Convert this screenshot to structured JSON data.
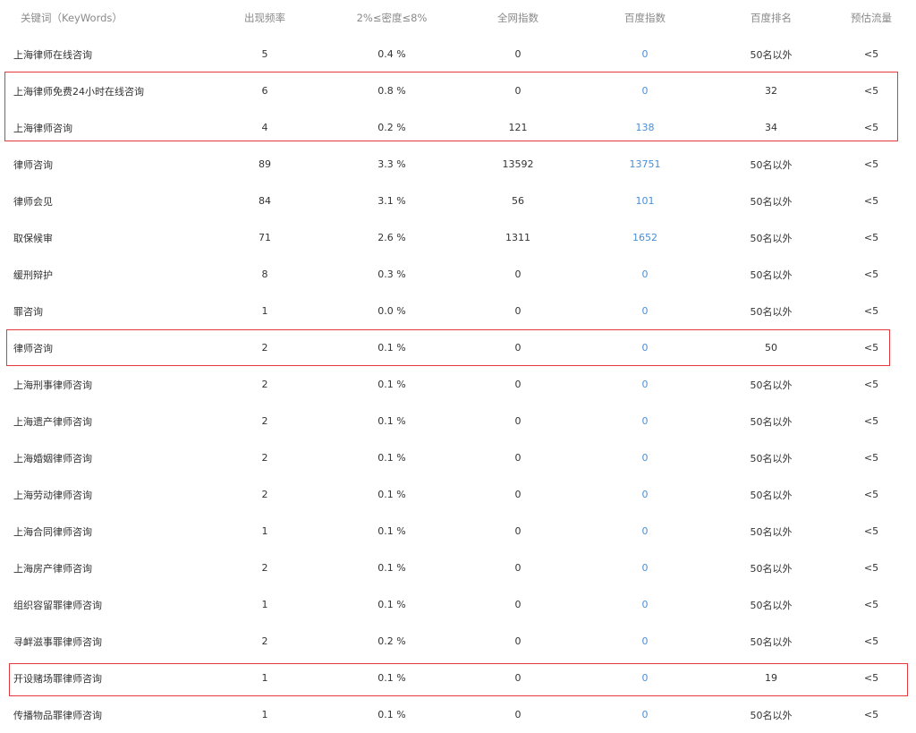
{
  "table": {
    "headers": {
      "keyword": "关键词（KeyWords）",
      "frequency": "出现频率",
      "density": "2%≤密度≤8%",
      "all_index": "全网指数",
      "baidu_index": "百度指数",
      "baidu_rank": "百度排名",
      "traffic": "预估流量"
    },
    "rows": [
      {
        "keyword": "上海律师在线咨询",
        "frequency": "5",
        "density": "0.4 %",
        "all_index": "0",
        "baidu_index": "0",
        "baidu_rank": "50名以外",
        "traffic": "<5"
      },
      {
        "keyword": "上海律师免费24小时在线咨询",
        "frequency": "6",
        "density": "0.8 %",
        "all_index": "0",
        "baidu_index": "0",
        "baidu_rank": "32",
        "traffic": "<5"
      },
      {
        "keyword": "上海律师咨询",
        "frequency": "4",
        "density": "0.2 %",
        "all_index": "121",
        "baidu_index": "138",
        "baidu_rank": "34",
        "traffic": "<5"
      },
      {
        "keyword": "律师咨询",
        "frequency": "89",
        "density": "3.3 %",
        "all_index": "13592",
        "baidu_index": "13751",
        "baidu_rank": "50名以外",
        "traffic": "<5"
      },
      {
        "keyword": "律师会见",
        "frequency": "84",
        "density": "3.1 %",
        "all_index": "56",
        "baidu_index": "101",
        "baidu_rank": "50名以外",
        "traffic": "<5"
      },
      {
        "keyword": "取保候审",
        "frequency": "71",
        "density": "2.6 %",
        "all_index": "1311",
        "baidu_index": "1652",
        "baidu_rank": "50名以外",
        "traffic": "<5"
      },
      {
        "keyword": "缓刑辩护",
        "frequency": "8",
        "density": "0.3 %",
        "all_index": "0",
        "baidu_index": "0",
        "baidu_rank": "50名以外",
        "traffic": "<5"
      },
      {
        "keyword": "罪咨询",
        "frequency": "1",
        "density": "0.0 %",
        "all_index": "0",
        "baidu_index": "0",
        "baidu_rank": "50名以外",
        "traffic": "<5"
      },
      {
        "keyword": "律师咨询",
        "frequency": "2",
        "density": "0.1 %",
        "all_index": "0",
        "baidu_index": "0",
        "baidu_rank": "50",
        "traffic": "<5"
      },
      {
        "keyword": "上海刑事律师咨询",
        "frequency": "2",
        "density": "0.1 %",
        "all_index": "0",
        "baidu_index": "0",
        "baidu_rank": "50名以外",
        "traffic": "<5"
      },
      {
        "keyword": "上海遗产律师咨询",
        "frequency": "2",
        "density": "0.1 %",
        "all_index": "0",
        "baidu_index": "0",
        "baidu_rank": "50名以外",
        "traffic": "<5"
      },
      {
        "keyword": "上海婚姻律师咨询",
        "frequency": "2",
        "density": "0.1 %",
        "all_index": "0",
        "baidu_index": "0",
        "baidu_rank": "50名以外",
        "traffic": "<5"
      },
      {
        "keyword": "上海劳动律师咨询",
        "frequency": "2",
        "density": "0.1 %",
        "all_index": "0",
        "baidu_index": "0",
        "baidu_rank": "50名以外",
        "traffic": "<5"
      },
      {
        "keyword": "上海合同律师咨询",
        "frequency": "1",
        "density": "0.1 %",
        "all_index": "0",
        "baidu_index": "0",
        "baidu_rank": "50名以外",
        "traffic": "<5"
      },
      {
        "keyword": "上海房产律师咨询",
        "frequency": "2",
        "density": "0.1 %",
        "all_index": "0",
        "baidu_index": "0",
        "baidu_rank": "50名以外",
        "traffic": "<5"
      },
      {
        "keyword": "组织容留罪律师咨询",
        "frequency": "1",
        "density": "0.1 %",
        "all_index": "0",
        "baidu_index": "0",
        "baidu_rank": "50名以外",
        "traffic": "<5"
      },
      {
        "keyword": "寻衅滋事罪律师咨询",
        "frequency": "2",
        "density": "0.2 %",
        "all_index": "0",
        "baidu_index": "0",
        "baidu_rank": "50名以外",
        "traffic": "<5"
      },
      {
        "keyword": "开设赌场罪律师咨询",
        "frequency": "1",
        "density": "0.1 %",
        "all_index": "0",
        "baidu_index": "0",
        "baidu_rank": "19",
        "traffic": "<5"
      },
      {
        "keyword": "传播物品罪律师咨询",
        "frequency": "1",
        "density": "0.1 %",
        "all_index": "0",
        "baidu_index": "0",
        "baidu_rank": "50名以外",
        "traffic": "<5"
      }
    ]
  },
  "colors": {
    "highlight_border": "#e4393c",
    "baidu_link": "#4a8fd6",
    "header_text": "#8a8a8a",
    "body_text": "#333333"
  }
}
